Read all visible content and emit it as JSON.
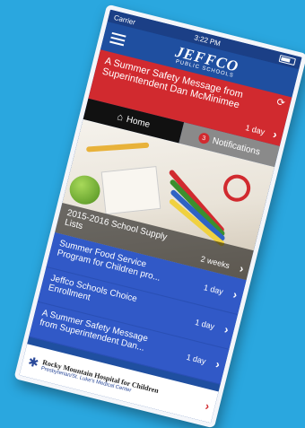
{
  "status": {
    "carrier": "Carrier",
    "time": "3:22 PM"
  },
  "header": {
    "brand": "JEFFCO",
    "subtitle": "PUBLIC SCHOOLS"
  },
  "alert": {
    "message": "A Summer Safety Message from Superintendent Dan McMinimee",
    "time": "1 day"
  },
  "tabs": {
    "home": "Home",
    "notifications": "Notifications",
    "badge": "3"
  },
  "hero": {
    "title": "2015-2016 School Supply Lists",
    "time": "2 weeks"
  },
  "list": [
    {
      "title": "Summer Food Service Program for Children pro...",
      "time": "1 day"
    },
    {
      "title": "Jeffco Schools Choice Enrollment",
      "time": "1 day"
    },
    {
      "title": "A Summer Safety Message from Superintendent Dan...",
      "time": "1 day"
    }
  ],
  "ad": {
    "name": "Rocky Mountain Hospital for Children",
    "tagline": "Presbyterian/St. Luke's Medical Center"
  },
  "colors": {
    "background": "#2aa7df",
    "header": "#1f4fa0",
    "alert": "#d12a2f",
    "list": "#3159c7"
  },
  "icons": {
    "menu": "menu-icon",
    "refresh": "refresh-icon",
    "home": "home-icon",
    "chevron": "chevron-right-icon"
  }
}
